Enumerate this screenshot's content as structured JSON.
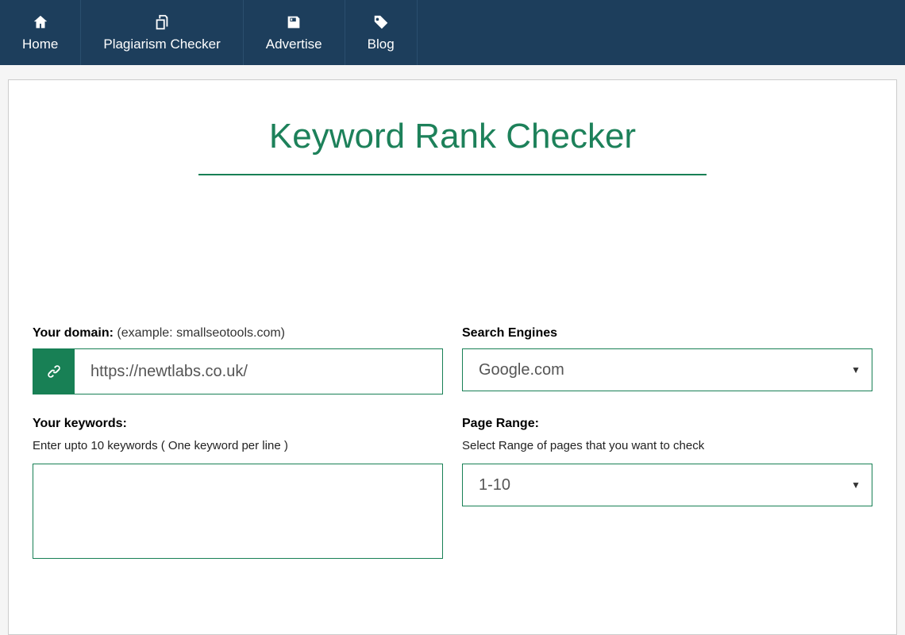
{
  "nav": {
    "items": [
      {
        "label": "Home"
      },
      {
        "label": "Plagiarism Checker"
      },
      {
        "label": "Advertise"
      },
      {
        "label": "Blog"
      }
    ]
  },
  "page": {
    "title": "Keyword Rank Checker"
  },
  "form": {
    "domain": {
      "label": "Your domain:",
      "hint": "(example: smallseotools.com)",
      "value": "https://newtlabs.co.uk/"
    },
    "searchEngines": {
      "label": "Search Engines",
      "selected": "Google.com"
    },
    "keywords": {
      "label": "Your keywords:",
      "sub": "Enter upto 10 keywords ( One keyword per line )",
      "value": ""
    },
    "pageRange": {
      "label": "Page Range:",
      "sub": "Select Range of pages that you want to check",
      "selected": "1-10"
    }
  }
}
